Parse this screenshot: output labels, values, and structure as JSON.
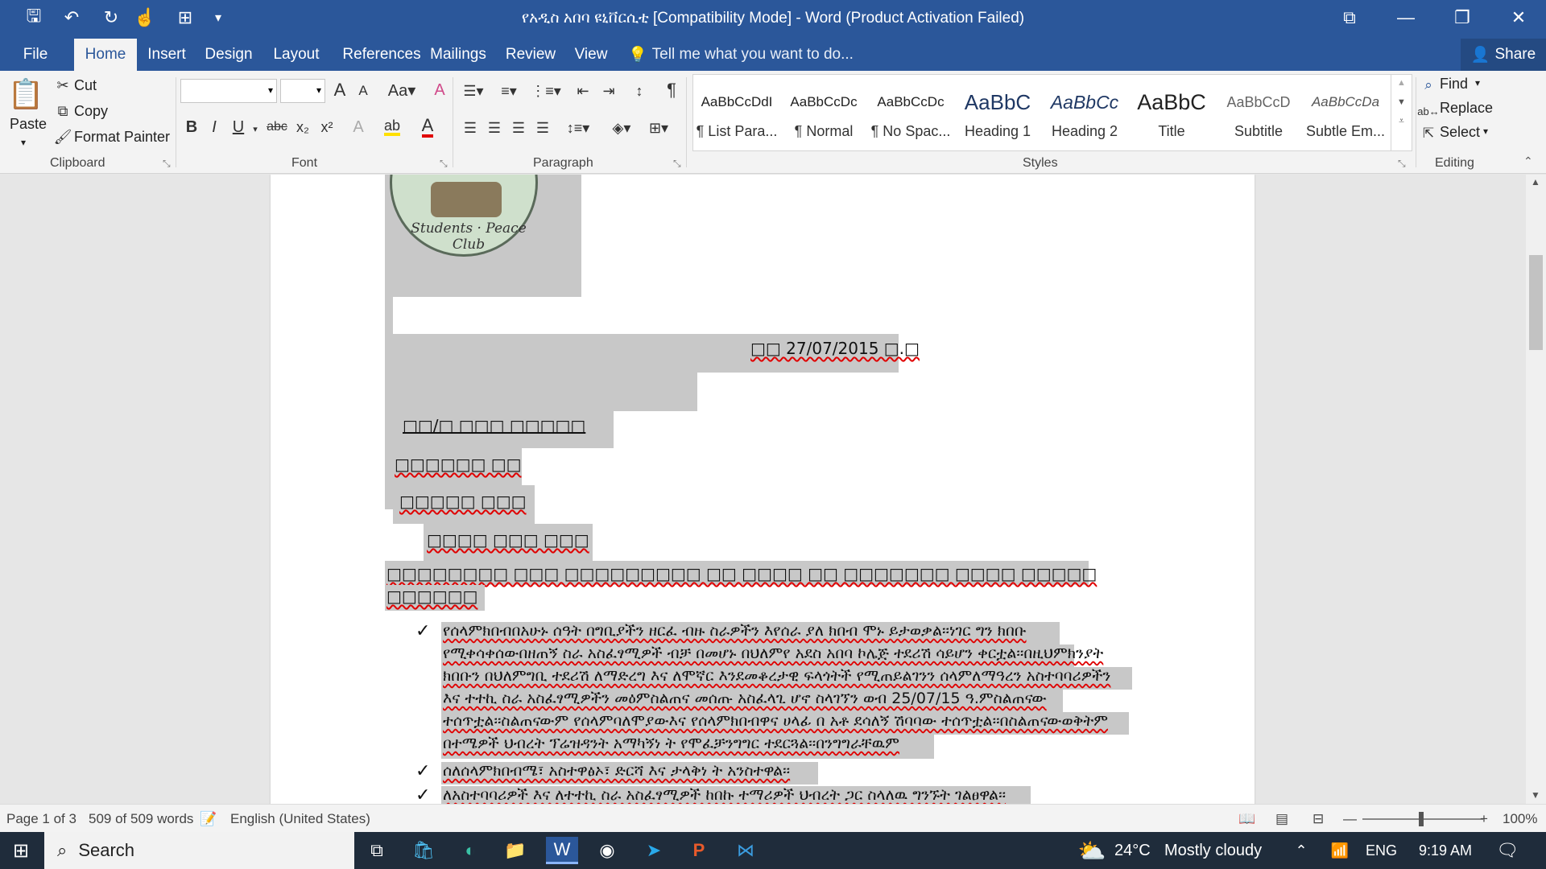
{
  "window": {
    "title": "የአዲስ አበባ ዩኒቨርሲቲ [Compatibility Mode] - Word (Product Activation Failed)",
    "controls": {
      "ribbon_display": "⧉",
      "minimize": "—",
      "restore": "❐",
      "close": "✕"
    }
  },
  "quick_access": {
    "save": "🖫",
    "undo": "↶",
    "redo": "↻",
    "touch": "☝",
    "form": "⊞",
    "customize": "▾"
  },
  "tabs": [
    {
      "label": "File",
      "active": false
    },
    {
      "label": "Home",
      "active": true
    },
    {
      "label": "Insert",
      "active": false
    },
    {
      "label": "Design",
      "active": false
    },
    {
      "label": "Layout",
      "active": false
    },
    {
      "label": "References",
      "active": false
    },
    {
      "label": "Mailings",
      "active": false
    },
    {
      "label": "Review",
      "active": false
    },
    {
      "label": "View",
      "active": false
    }
  ],
  "tell_me": "Tell me what you want to do...",
  "share": "Share",
  "ribbon": {
    "clipboard": {
      "label": "Clipboard",
      "paste": "Paste",
      "cut": "Cut",
      "copy": "Copy",
      "format_painter": "Format Painter"
    },
    "font": {
      "label": "Font",
      "font_name": "",
      "font_size": "",
      "bold": "B",
      "italic": "I",
      "underline": "U",
      "strike": "abc",
      "subscript": "x₂",
      "superscript": "x²"
    },
    "paragraph": {
      "label": "Paragraph",
      "pilcrow": "¶"
    },
    "styles": {
      "label": "Styles",
      "items": [
        {
          "sample": "AaBbCcDdI",
          "name": "¶ List Para..."
        },
        {
          "sample": "AaBbCcDc",
          "name": "¶ Normal"
        },
        {
          "sample": "AaBbCcDc",
          "name": "¶ No Spac..."
        },
        {
          "sample": "AaBbC",
          "name": "Heading 1"
        },
        {
          "sample": "AaBbCc",
          "name": "Heading 2"
        },
        {
          "sample": "AaBbC",
          "name": "Title"
        },
        {
          "sample": "AaBbCcD",
          "name": "Subtitle"
        },
        {
          "sample": "AaBbCcDa",
          "name": "Subtle Em..."
        }
      ]
    },
    "editing": {
      "label": "Editing",
      "find": "Find",
      "replace": "Replace",
      "select": "Select"
    }
  },
  "document": {
    "logo_text": "Students · Peace Club",
    "date_line": "□□ 27/07/2015 □.□",
    "recipient_lines": [
      "□□/□ □□□ □□□□□",
      "□□□□□□ □□",
      "□□□□□ □□□",
      "□□□□ □□□ □□□"
    ],
    "subject_line_1": "□□□□□□□□ □□□ □□□□□□□□□ □□ □□□□ □□ □□□□□□□ □□□□ □□□□□",
    "subject_line_2": "□□□□□□",
    "bullet_1_lines": [
      "የሰላምክበብበአሁኑ ሰዓት በግቢያችን ዘርፈ ብዙ ስራዎችን እየሰራ ያለ ክበብ ሞኑ ይታወቃል፡፡ነገር ግን ክበቡ",
      "የሚቀሳቀሰውበዘጠኝ ስራ አስፈፃሚዎች ብቻ በመሆኑ በህለምየ አደስ አበባ ኮሌጅ ተደሪሽ ሳይሆን ቀርቷል፡፡በዚህምክንያት",
      "ክበቡን በህለምግቢ ተደሪሽ ለማድረግ እና ለሞኛር እንደመቆረታዊ ፍላጎትች የሚጠይልገንን ሰላምለማዓረን አስተባባሪዎችን",
      "እና ተተኪ ስራ አስፈፃሚዎችን መዕምስልጠና መሰጡ አስፈላጊ ሆኖ ስላገኘን ወብ 25/07/15 ዓ.ምስልጠናው",
      "ተሰጥቷል፡፡ስልጠናውም  የሰላምባለሞያውእና የሰላምክበብዋና ሀላፊ በ አቶ ደሳለኝ ሽባባው ተሰጥቷል፡፡በስልጠናውወቅትም",
      "በተሜዎች ህብረት ፕሬዝዳንት አማካኝነ ት የሞፈቻንግግር ተደርጓል፡፡በንግግራቸዉም"
    ],
    "bullet_2": "ሰለሰላምክበብሜ፣ አስተዋፅኦ፣ ድርሻ እና ታላቅነ ት አንስተዋል፡፡",
    "bullet_3": "ለአስተባባሪዎች እና ለተተኪ ስራ አስፈፃሚዎች ከበኩ ተማሪዎች ህብረት ጋር ስላለዉ ግንኙት ገልፀዋል፡፡"
  },
  "status": {
    "page": "Page 1 of 3",
    "words": "509 of 509 words",
    "language": "English (United States)",
    "zoom": "100%"
  },
  "taskbar": {
    "search": "Search",
    "weather_temp": "24°C",
    "weather_desc": "Mostly cloudy",
    "lang": "ENG",
    "time": "9:19 AM"
  },
  "colors": {
    "title_blue": "#2b579a",
    "ribbon_bg": "#f3f3f3",
    "highlight": "#c8c8c8",
    "taskbar": "#1f2c3b"
  }
}
